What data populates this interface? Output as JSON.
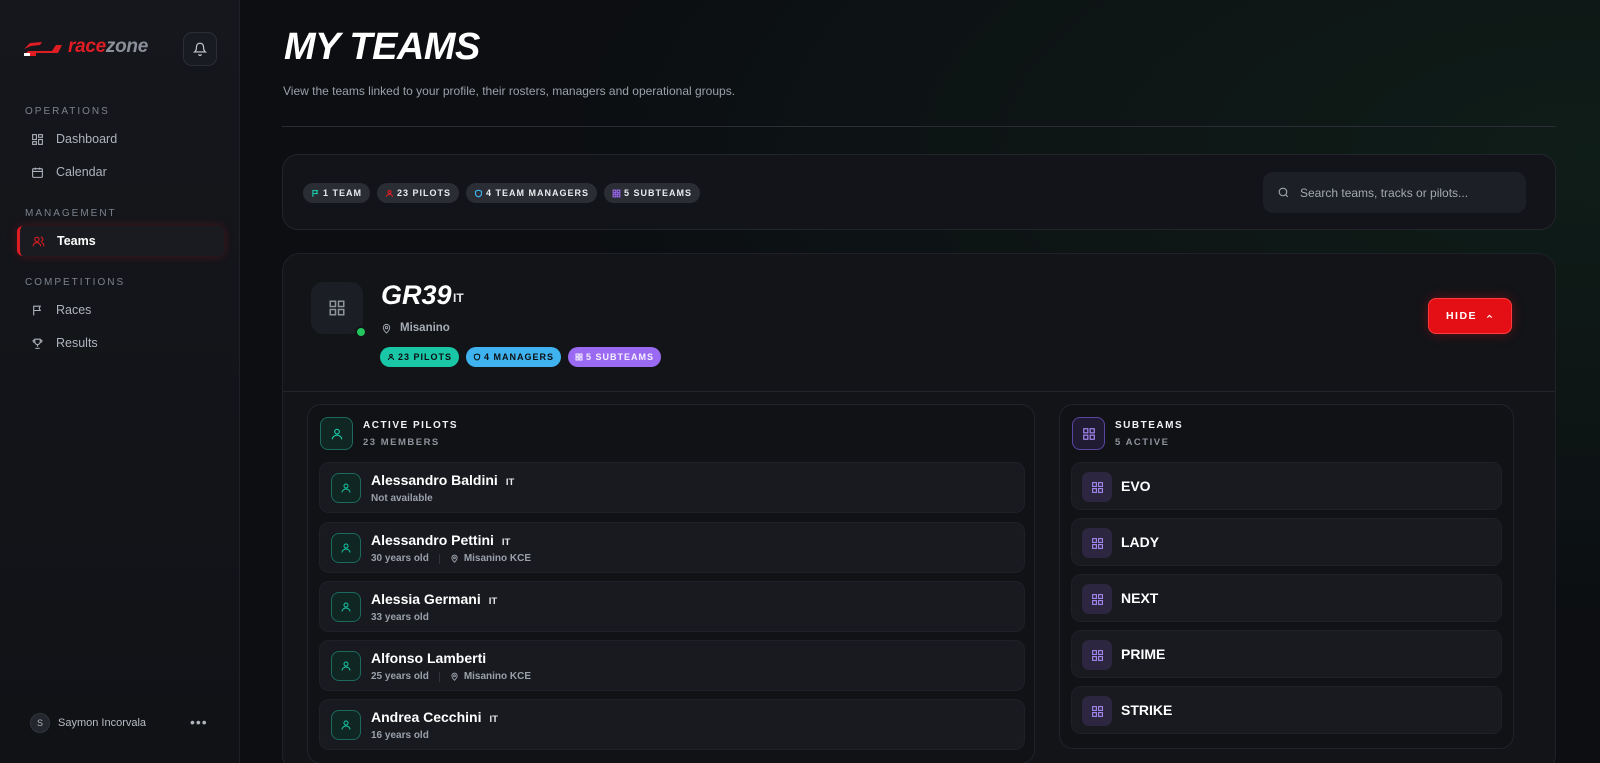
{
  "brand": {
    "name_part1": "race",
    "name_part2": "zone",
    "accent": "#e11d24"
  },
  "sidebar": {
    "sections": [
      {
        "label": "OPERATIONS"
      },
      {
        "label": "MANAGEMENT"
      },
      {
        "label": "COMPETITIONS"
      }
    ],
    "items": [
      {
        "label": "Dashboard",
        "icon": "dashboard-icon"
      },
      {
        "label": "Calendar",
        "icon": "calendar-icon"
      },
      {
        "label": "Teams",
        "icon": "users-icon",
        "active": true
      },
      {
        "label": "Races",
        "icon": "flag-icon"
      },
      {
        "label": "Results",
        "icon": "trophy-icon"
      }
    ],
    "user": {
      "initial": "S",
      "name": "Saymon Incorvala",
      "more": "•••"
    }
  },
  "header": {
    "title": "MY TEAMS",
    "subtitle": "View the teams linked to your profile, their rosters, managers and operational groups."
  },
  "summary": {
    "chips": [
      {
        "label": "1 TEAM",
        "icon": "flag-icon"
      },
      {
        "label": "23 PILOTS",
        "icon": "user-icon"
      },
      {
        "label": "4 TEAM MANAGERS",
        "icon": "shield-icon"
      },
      {
        "label": "5 SUBTEAMS",
        "icon": "grid-icon"
      }
    ],
    "search_placeholder": "Search teams, tracks or pilots..."
  },
  "team": {
    "name": "GR39",
    "country": "IT",
    "location": "Misanino",
    "badges": [
      {
        "label": "23 PILOTS",
        "color": "#19c7a6"
      },
      {
        "label": "4 MANAGERS",
        "color": "#3fb3ef"
      },
      {
        "label": "5 SUBTEAMS",
        "color": "#9b6af2"
      }
    ],
    "hide_label": "HIDE",
    "status_color": "#22c55e"
  },
  "pilots_panel": {
    "title": "ACTIVE PILOTS",
    "subtitle": "23 MEMBERS",
    "rows": [
      {
        "name": "Alessandro Baldini",
        "country": "IT",
        "meta": "Not available",
        "location": ""
      },
      {
        "name": "Alessandro Pettini",
        "country": "IT",
        "meta": "30 years old",
        "location": "Misanino KCE"
      },
      {
        "name": "Alessia Germani",
        "country": "IT",
        "meta": "33 years old",
        "location": ""
      },
      {
        "name": "Alfonso Lamberti",
        "country": "",
        "meta": "25 years old",
        "location": "Misanino KCE"
      },
      {
        "name": "Andrea Cecchini",
        "country": "IT",
        "meta": "16 years old",
        "location": ""
      }
    ]
  },
  "subteams_panel": {
    "title": "SUBTEAMS",
    "subtitle": "5 ACTIVE",
    "rows": [
      {
        "name": "EVO"
      },
      {
        "name": "LADY"
      },
      {
        "name": "NEXT"
      },
      {
        "name": "PRIME"
      },
      {
        "name": "STRIKE"
      }
    ]
  }
}
